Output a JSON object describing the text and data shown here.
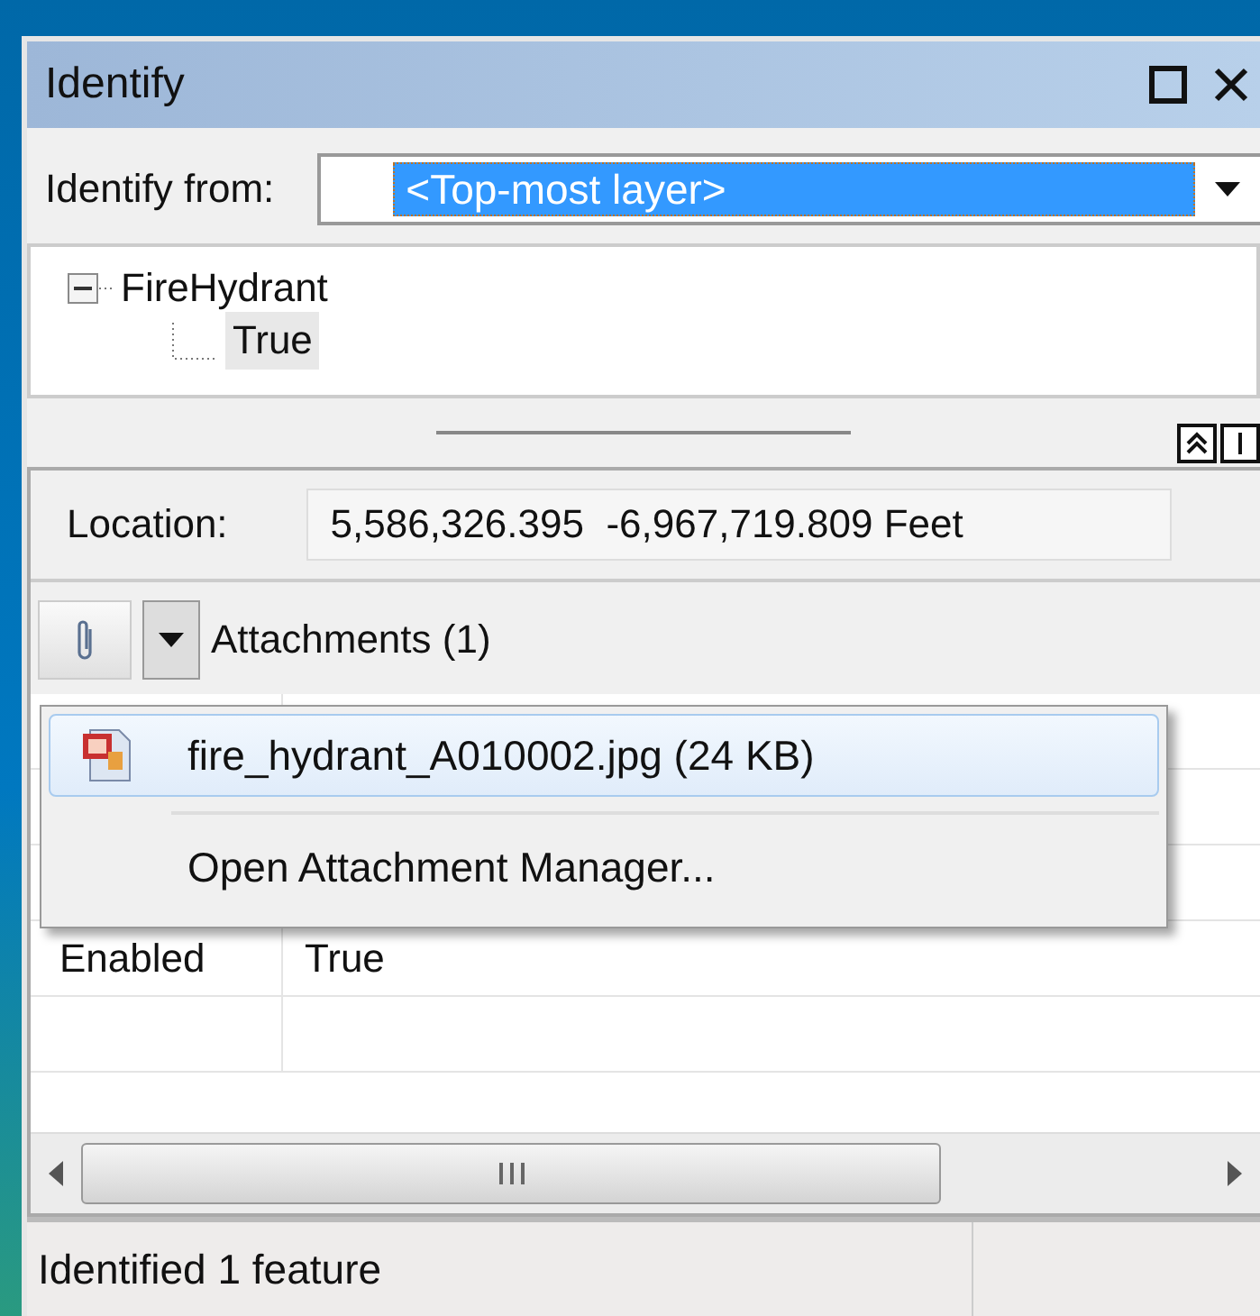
{
  "window": {
    "title": "Identify"
  },
  "identify_from": {
    "label": "Identify from:",
    "value": "<Top-most layer>"
  },
  "tree": [
    {
      "label": "FireHydrant",
      "expanded": true,
      "children": [
        {
          "label": "True",
          "selected": true
        }
      ]
    }
  ],
  "location": {
    "label": "Location:",
    "value": "5,586,326.395  -6,967,719.809 Feet"
  },
  "attachments": {
    "label": "Attachments (1)"
  },
  "attachment_menu": [
    {
      "kind": "file",
      "label": "fire_hydrant_A010002.jpg (24 KB)",
      "selected": true
    },
    {
      "kind": "command",
      "label": "Open Attachment Manager...",
      "selected": false
    }
  ],
  "fields": [
    {
      "name": "Enabled",
      "value": "True"
    }
  ],
  "status_bar": {
    "text": "Identified 1 feature"
  }
}
